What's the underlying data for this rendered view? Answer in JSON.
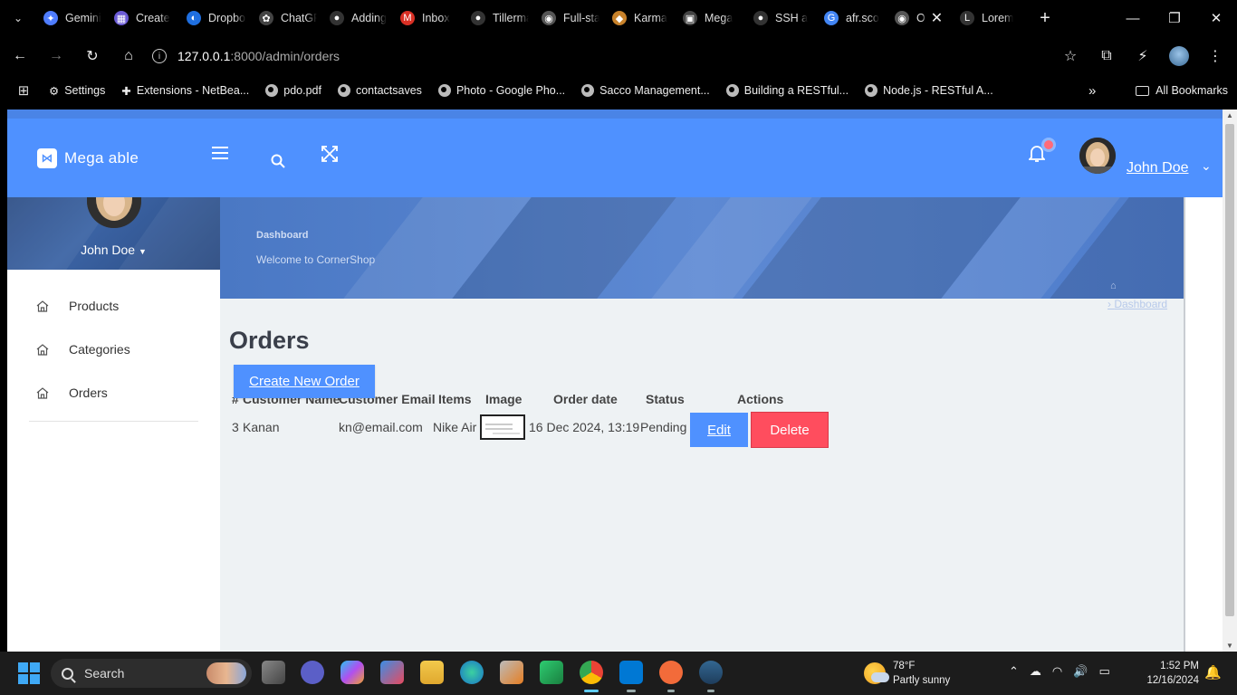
{
  "browser": {
    "tabs": [
      {
        "title": "Gemini",
        "color": "#4f7dff",
        "glyph": "✦"
      },
      {
        "title": "Create",
        "color": "#6b5bd6",
        "glyph": "▦"
      },
      {
        "title": "Dropbox",
        "color": "#1f6fe0",
        "glyph": "◐"
      },
      {
        "title": "ChatGPT",
        "color": "#444444",
        "glyph": "✿"
      },
      {
        "title": "Adding",
        "color": "#333333",
        "glyph": "●"
      },
      {
        "title": "Inbox",
        "color": "#d93025",
        "glyph": "M"
      },
      {
        "title": "Tillerman",
        "color": "#333333",
        "glyph": "●"
      },
      {
        "title": "Full-stack",
        "color": "#555555",
        "glyph": "◉"
      },
      {
        "title": "Karma",
        "color": "#c8822b",
        "glyph": "◆"
      },
      {
        "title": "Mega",
        "color": "#444444",
        "glyph": "▣"
      },
      {
        "title": "SSH a",
        "color": "#333333",
        "glyph": "●"
      },
      {
        "title": "afr.sco",
        "color": "#4285f4",
        "glyph": "G"
      },
      {
        "title": "O",
        "color": "#555555",
        "glyph": "◉"
      },
      {
        "title": "Lorem",
        "color": "#333333",
        "glyph": "L"
      }
    ],
    "new_tab_label": "+",
    "url_host": "127.0.0.1",
    "url_path": ":8000/admin/orders",
    "bookmarks": [
      "Settings",
      "Extensions - NetBea...",
      "pdo.pdf",
      "contactsaves",
      "Photo - Google Pho...",
      "Sacco Management...",
      "Building a RESTful...",
      "Node.js - RESTful A..."
    ],
    "all_bookmarks_label": "All Bookmarks"
  },
  "app": {
    "brand": "Mega able",
    "user_name": "John Doe",
    "sidebar": {
      "user_name": "John Doe",
      "items": [
        {
          "label": "Products"
        },
        {
          "label": "Categories"
        },
        {
          "label": "Orders"
        }
      ]
    },
    "banner": {
      "title": "Dashboard",
      "subtitle": "Welcome to CornerShop",
      "breadcrumb": "Dashboard"
    }
  },
  "orders": {
    "page_title": "Orders",
    "create_button": "Create New Order",
    "columns": [
      "#",
      "Customer Name",
      "Customer Email",
      "Items",
      "Image",
      "Order date",
      "Status",
      "Actions"
    ],
    "rows": [
      {
        "id": "3",
        "customer_name": "Kanan",
        "customer_email": "kn@email.com",
        "items": "Nike Air",
        "order_date": "16 Dec 2024, 13:19",
        "status": "Pending",
        "edit_label": "Edit",
        "delete_label": "Delete"
      }
    ]
  },
  "taskbar": {
    "search_label": "Search",
    "weather_temp": "78°F",
    "weather_desc": "Partly sunny",
    "time": "1:52 PM",
    "date": "12/16/2024"
  },
  "colors": {
    "header_blue": "#4f91ff",
    "delete_red": "#ff4d5e",
    "content_bg": "#eef2f4"
  }
}
